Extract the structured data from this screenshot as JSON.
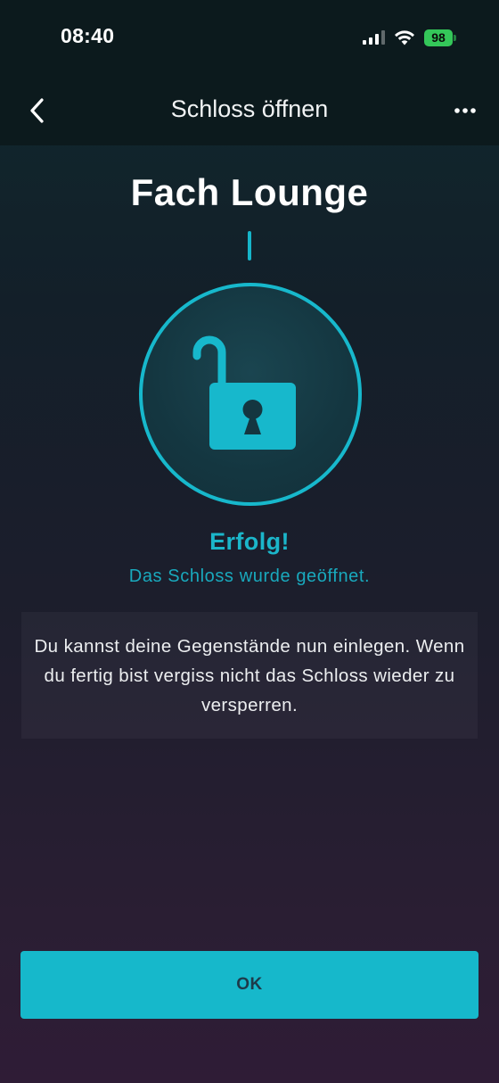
{
  "status_bar": {
    "time": "08:40",
    "battery": "98"
  },
  "nav": {
    "title": "Schloss öffnen"
  },
  "main": {
    "title": "Fach Lounge",
    "status_title": "Erfolg!",
    "status_subtitle": "Das Schloss wurde geöffnet.",
    "info_text": "Du kannst deine Gegenstände nun einlegen. Wenn du fertig bist vergiss nicht das Schloss wieder zu versperren."
  },
  "actions": {
    "ok_label": "OK"
  },
  "colors": {
    "accent": "#16b8cb",
    "battery": "#34c759",
    "topbar": "#0c1a1d"
  },
  "icons": {
    "lock": "lock-open-icon",
    "back": "chevron-left-icon",
    "more": "more-horizontal-icon"
  }
}
